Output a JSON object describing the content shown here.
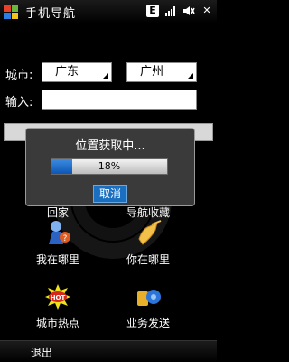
{
  "app": {
    "title": "手机导航"
  },
  "status": {
    "e_badge": "E",
    "volume_icon": "volume-icon",
    "signal_icon": "signal-icon",
    "close_glyph": "✕"
  },
  "form": {
    "city_label": "城市:",
    "province_value": "广东",
    "city_value": "广州",
    "input_label": "输入:",
    "input_value": ""
  },
  "grid": [
    {
      "label": "回家",
      "icon": "home-icon"
    },
    {
      "label": "导航收藏",
      "icon": "favorites-icon"
    },
    {
      "label": "我在哪里",
      "icon": "where-am-i-icon"
    },
    {
      "label": "你在哪里",
      "icon": "where-are-you-icon"
    },
    {
      "label": "城市热点",
      "icon": "hot-icon"
    },
    {
      "label": "业务发送",
      "icon": "service-send-icon"
    }
  ],
  "dialog": {
    "title": "位置获取中...",
    "progress": 0.18,
    "progress_text": "18%",
    "cancel_label": "取消"
  },
  "softkeys": {
    "left": "退出"
  },
  "colors": {
    "accent": "#1a6fc1",
    "progress_fill": "#1f6fd0"
  }
}
